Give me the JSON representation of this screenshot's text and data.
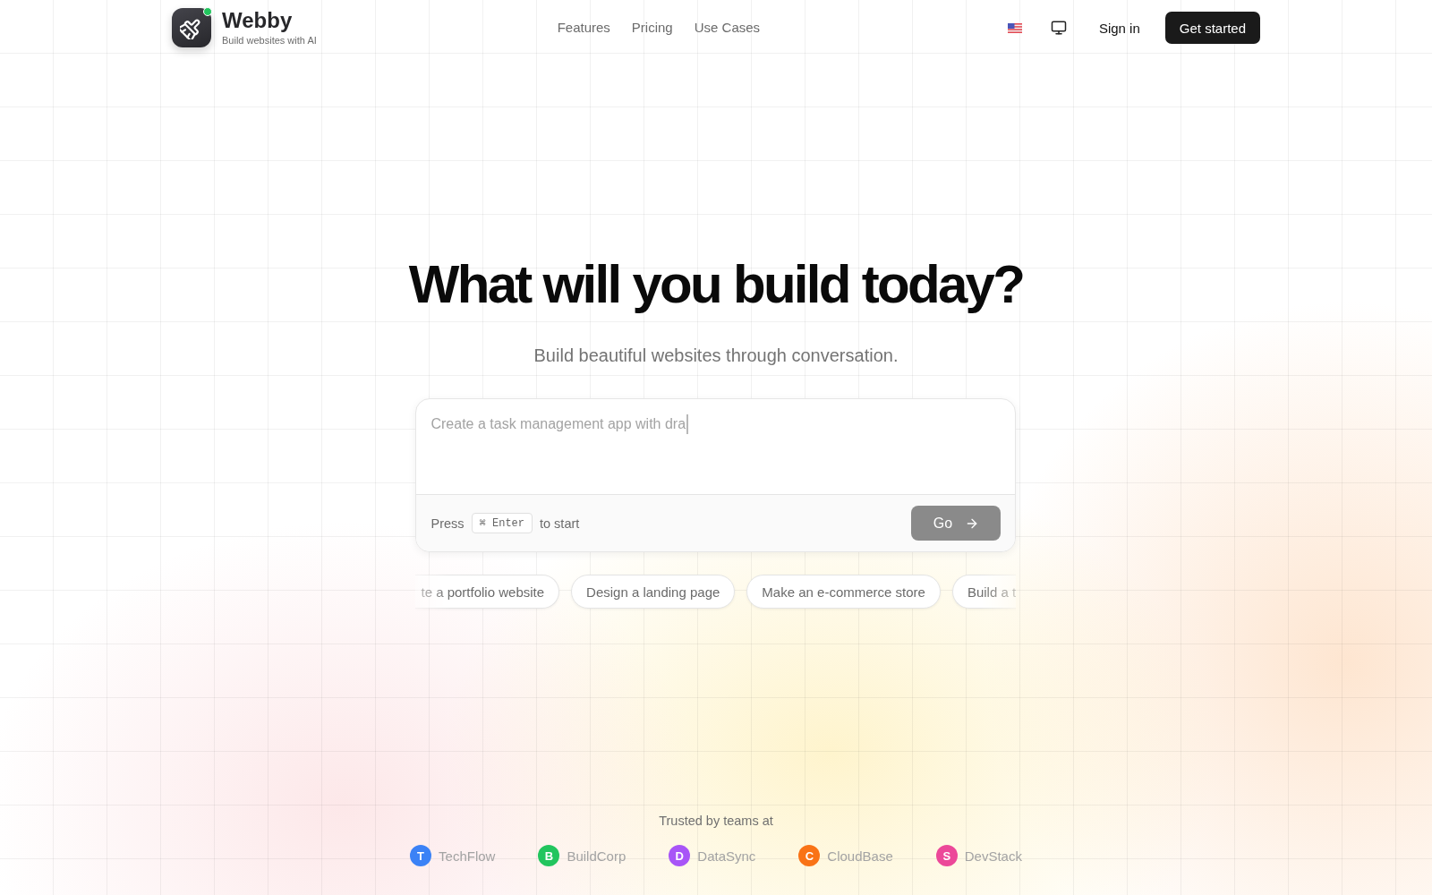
{
  "header": {
    "logo": {
      "name": "Webby",
      "tagline": "Build websites with AI",
      "online": true
    },
    "nav": [
      "Features",
      "Pricing",
      "Use Cases"
    ],
    "sign_in": "Sign in",
    "get_started": "Get started"
  },
  "hero": {
    "title": "What will you build today?",
    "subtitle": "Build beautiful websites through conversation."
  },
  "prompt": {
    "placeholder": "Create a task management app with dra",
    "cursor_visible": true,
    "hint_before": "Press",
    "shortcut": "⌘ Enter",
    "hint_after": "to start",
    "submit": {
      "label": "Go",
      "disabled": true
    }
  },
  "suggestions": [
    "te a portfolio website",
    "Design a landing page",
    "Make an e-commerce store",
    "Build a t"
  ],
  "trusted": {
    "label": "Trusted by teams at",
    "companies": [
      {
        "initial": "T",
        "name": "TechFlow",
        "color": "#3b82f6"
      },
      {
        "initial": "B",
        "name": "BuildCorp",
        "color": "#22c55e"
      },
      {
        "initial": "D",
        "name": "DataSync",
        "color": "#a855f7"
      },
      {
        "initial": "C",
        "name": "CloudBase",
        "color": "#f97316"
      },
      {
        "initial": "S",
        "name": "DevStack",
        "color": "#ec4899"
      }
    ]
  }
}
